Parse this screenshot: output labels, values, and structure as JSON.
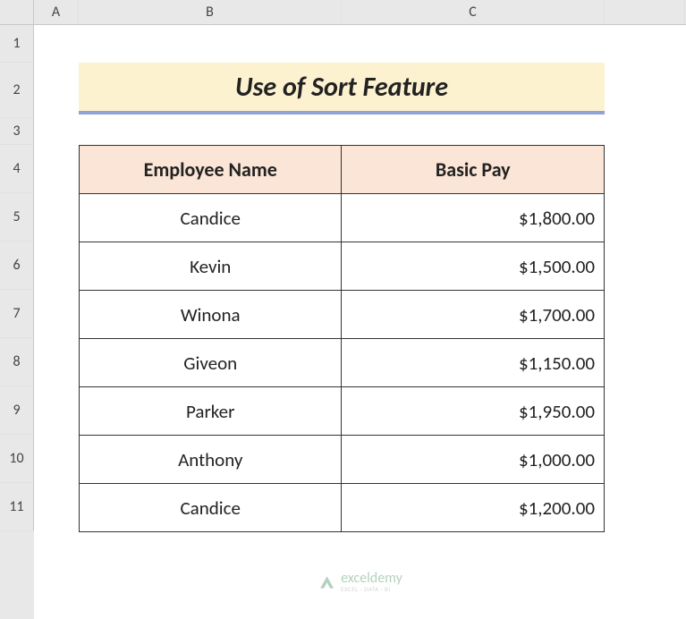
{
  "columns": [
    "A",
    "B",
    "C",
    ""
  ],
  "rows": [
    "1",
    "2",
    "3",
    "4",
    "5",
    "6",
    "7",
    "8",
    "9",
    "10",
    "11"
  ],
  "title": "Use of Sort Feature",
  "headers": {
    "name": "Employee Name",
    "pay": "Basic Pay"
  },
  "chart_data": {
    "type": "table",
    "title": "Use of Sort Feature",
    "columns": [
      "Employee Name",
      "Basic Pay"
    ],
    "rows": [
      {
        "name": "Candice",
        "pay": "$1,800.00"
      },
      {
        "name": "Kevin",
        "pay": "$1,500.00"
      },
      {
        "name": "Winona",
        "pay": "$1,700.00"
      },
      {
        "name": "Giveon",
        "pay": "$1,150.00"
      },
      {
        "name": "Parker",
        "pay": "$1,950.00"
      },
      {
        "name": "Anthony",
        "pay": "$1,000.00"
      },
      {
        "name": "Candice",
        "pay": "$1,200.00"
      }
    ]
  },
  "watermark": {
    "main": "exceldemy",
    "sub": "EXCEL · DATA · BI"
  }
}
